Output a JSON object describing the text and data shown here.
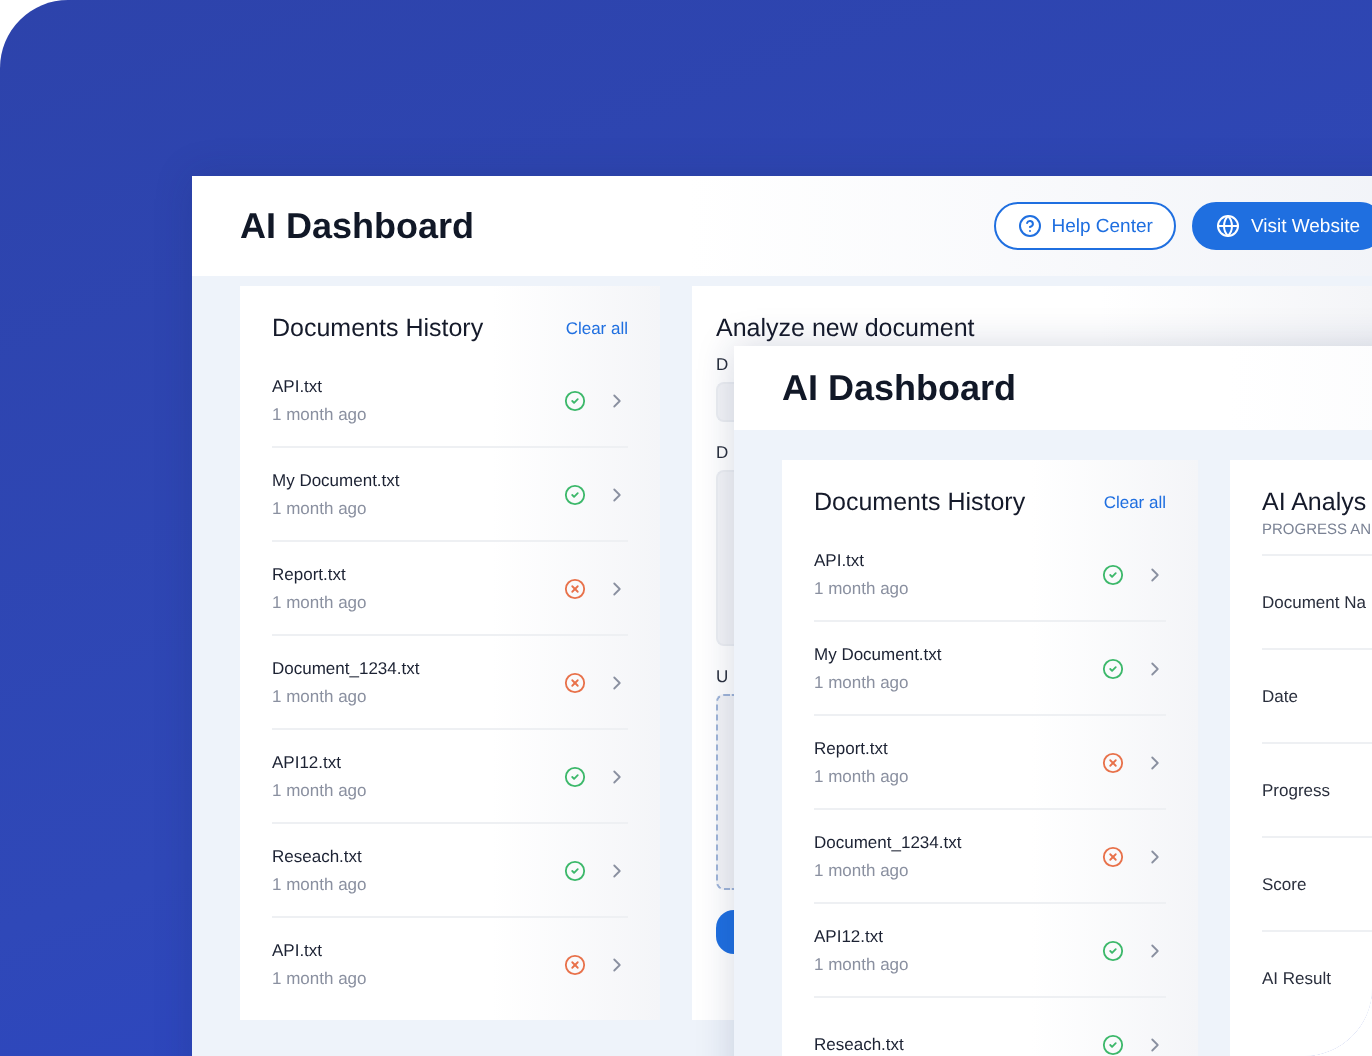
{
  "back_window": {
    "title": "AI Dashboard",
    "buttons": [
      {
        "label": "Help Center",
        "kind": "outline"
      },
      {
        "label": "Visit Website",
        "kind": "filled"
      }
    ],
    "history": {
      "title": "Documents History",
      "action": "Clear all",
      "items": [
        {
          "name": "API.txt",
          "time": "1 month ago",
          "kind": "success"
        },
        {
          "name": "My Document.txt",
          "time": "1 month ago",
          "kind": "success"
        },
        {
          "name": "Report.txt",
          "time": "1 month ago",
          "kind": "failed"
        },
        {
          "name": "Document_1234.txt",
          "time": "1 month ago",
          "kind": "failed"
        },
        {
          "name": "API12.txt",
          "time": "1 month ago",
          "kind": "success"
        },
        {
          "name": "Reseach.txt",
          "time": "1 month ago",
          "kind": "success"
        },
        {
          "name": "API.txt",
          "time": "1 month ago",
          "kind": "failed"
        }
      ]
    },
    "analyze": {
      "title": "Analyze new document",
      "field_labels": [
        "D",
        "D"
      ],
      "upload_label": "U"
    }
  },
  "front_window": {
    "title": "AI Dashboard",
    "history": {
      "title": "Documents History",
      "action": "Clear all",
      "items": [
        {
          "name": "API.txt",
          "time": "1 month ago",
          "kind": "success"
        },
        {
          "name": "My Document.txt",
          "time": "1 month ago",
          "kind": "success"
        },
        {
          "name": "Report.txt",
          "time": "1 month ago",
          "kind": "failed"
        },
        {
          "name": "Document_1234.txt",
          "time": "1 month ago",
          "kind": "failed"
        },
        {
          "name": "API12.txt",
          "time": "1 month ago",
          "kind": "success"
        },
        {
          "name": "Reseach.txt",
          "kind": "success"
        }
      ]
    },
    "analysis": {
      "title": "AI Analys",
      "subtitle": "PROGRESS AN",
      "rows": [
        "Document Na",
        "Date",
        "Progress",
        "Score",
        "AI Result"
      ]
    }
  }
}
